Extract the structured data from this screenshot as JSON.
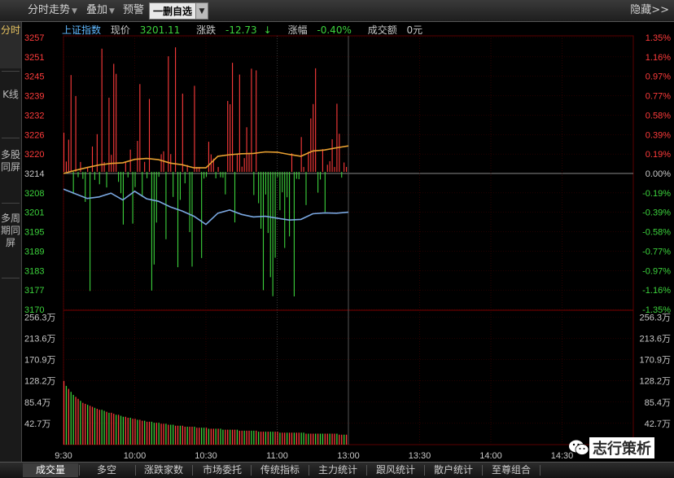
{
  "toolbar": {
    "intraday_label": "分时走势",
    "overlay_label": "叠加",
    "alert_label": "预警",
    "delete_watchlist_label": "一删自选",
    "hide_label": "隐藏>>"
  },
  "sidebar": {
    "items": [
      {
        "label": "分时",
        "active": true
      },
      {
        "label": "K线",
        "active": false
      },
      {
        "label": "多股同屏",
        "active": false
      },
      {
        "label": "多周期同屏",
        "active": false
      }
    ]
  },
  "info": {
    "index_name": "上证指数",
    "price_label": "现价",
    "price_value": "3201.11",
    "change_label": "涨跌",
    "change_value": "-12.73",
    "change_arrow": "↓",
    "pct_label": "涨幅",
    "pct_value": "-0.40%",
    "turnover_label": "成交额",
    "turnover_value": "0元"
  },
  "colors": {
    "up": "#ff3b3b",
    "down": "#3cd23c",
    "price_line": "#7aa7e0",
    "avg_line": "#e8a030",
    "grid": "#3a0000",
    "accent": "#e8c460"
  },
  "chart_data": [
    {
      "type": "line",
      "title": "上证指数",
      "y_ticks_left": [
        "3257",
        "3251",
        "3245",
        "3239",
        "3232",
        "3226",
        "3220",
        "3214",
        "3208",
        "3201",
        "3195",
        "3189",
        "3183",
        "3177",
        "3170"
      ],
      "y_ticks_right": [
        "1.35%",
        "1.16%",
        "0.97%",
        "0.77%",
        "0.58%",
        "0.39%",
        "0.19%",
        "0.00%",
        "-0.19%",
        "-0.39%",
        "-0.58%",
        "-0.77%",
        "-0.97%",
        "-1.16%",
        "-1.35%"
      ],
      "ylim": [
        3170,
        3257
      ],
      "prev_close": 3214,
      "x_ticks": [
        "9:30",
        "10:00",
        "10:30",
        "11:00",
        "13:00",
        "13:30",
        "14:00",
        "14:30"
      ],
      "series": [
        {
          "name": "price",
          "x": [
            "9:30",
            "9:35",
            "9:40",
            "9:45",
            "9:50",
            "9:55",
            "10:00",
            "10:05",
            "10:10",
            "10:15",
            "10:20",
            "10:25",
            "10:30",
            "10:35",
            "10:40",
            "10:45",
            "10:50",
            "10:55",
            "11:00",
            "11:05",
            "11:10",
            "11:15",
            "11:20",
            "11:25",
            "11:30"
          ],
          "values": [
            3208.5,
            3207,
            3205.5,
            3206,
            3207.2,
            3205,
            3207.8,
            3205.4,
            3204.6,
            3202.8,
            3201.5,
            3199.8,
            3197.2,
            3200.8,
            3201.8,
            3200.4,
            3199.6,
            3199.8,
            3199.2,
            3198.6,
            3198.8,
            3200.6,
            3200.9,
            3200.8,
            3201.1
          ]
        },
        {
          "name": "average",
          "x": [
            "9:30",
            "9:35",
            "9:40",
            "9:45",
            "9:50",
            "9:55",
            "10:00",
            "10:05",
            "10:10",
            "10:15",
            "10:20",
            "10:25",
            "10:30",
            "10:35",
            "10:40",
            "10:45",
            "10:50",
            "10:55",
            "11:00",
            "11:05",
            "11:10",
            "11:15",
            "11:20",
            "11:25",
            "11:30"
          ],
          "values": [
            3213.5,
            3214.5,
            3215.4,
            3216.2,
            3216.7,
            3216.9,
            3218,
            3218.3,
            3217.9,
            3216.8,
            3216.3,
            3215.3,
            3215.3,
            3219,
            3219.5,
            3219.8,
            3219.9,
            3220.4,
            3220.3,
            3219.6,
            3219,
            3220.7,
            3221,
            3221.7,
            3222.3
          ]
        }
      ]
    },
    {
      "type": "bar",
      "title": "成交量",
      "y_ticks": [
        "256.3万",
        "213.6万",
        "170.9万",
        "128.2万",
        "85.4万",
        "42.7万"
      ],
      "ylim": [
        0,
        270
      ],
      "x_ticks": [
        "9:30",
        "10:00",
        "10:30",
        "11:00",
        "13:00",
        "13:30",
        "14:00",
        "14:30"
      ],
      "values": [
        128,
        118,
        112,
        106,
        100,
        96,
        92,
        88,
        84,
        82,
        80,
        78,
        76,
        74,
        72,
        70,
        70,
        68,
        66,
        64,
        64,
        62,
        60,
        60,
        58,
        56,
        56,
        54,
        54,
        52,
        52,
        50,
        50,
        48,
        48,
        46,
        46,
        46,
        44,
        44,
        44,
        42,
        42,
        42,
        40,
        40,
        40,
        38,
        38,
        38,
        38,
        36,
        36,
        36,
        36,
        36,
        34,
        34,
        34,
        34,
        34,
        32,
        32,
        32,
        32,
        32,
        32,
        30,
        30,
        30,
        30,
        30,
        30,
        30,
        28,
        28,
        28,
        28,
        28,
        28,
        28,
        28,
        26,
        26,
        26,
        26,
        26,
        26,
        26,
        26,
        26,
        24,
        24,
        24,
        24,
        24,
        24,
        24,
        24,
        24,
        24,
        24,
        22,
        22,
        22,
        22,
        22,
        22,
        22,
        22,
        22,
        22,
        22,
        22,
        22,
        22,
        20,
        20,
        20,
        20
      ]
    }
  ],
  "tabs": [
    {
      "label": "成交量",
      "active": true
    },
    {
      "label": "多空",
      "active": false
    },
    {
      "label": "涨跌家数",
      "active": false
    },
    {
      "label": "市场委托",
      "active": false
    },
    {
      "label": "传统指标",
      "active": false
    },
    {
      "label": "主力统计",
      "active": false
    },
    {
      "label": "跟风统计",
      "active": false
    },
    {
      "label": "散户统计",
      "active": false
    },
    {
      "label": "至尊组合",
      "active": false
    }
  ],
  "watermark": {
    "text": "志行策析"
  }
}
